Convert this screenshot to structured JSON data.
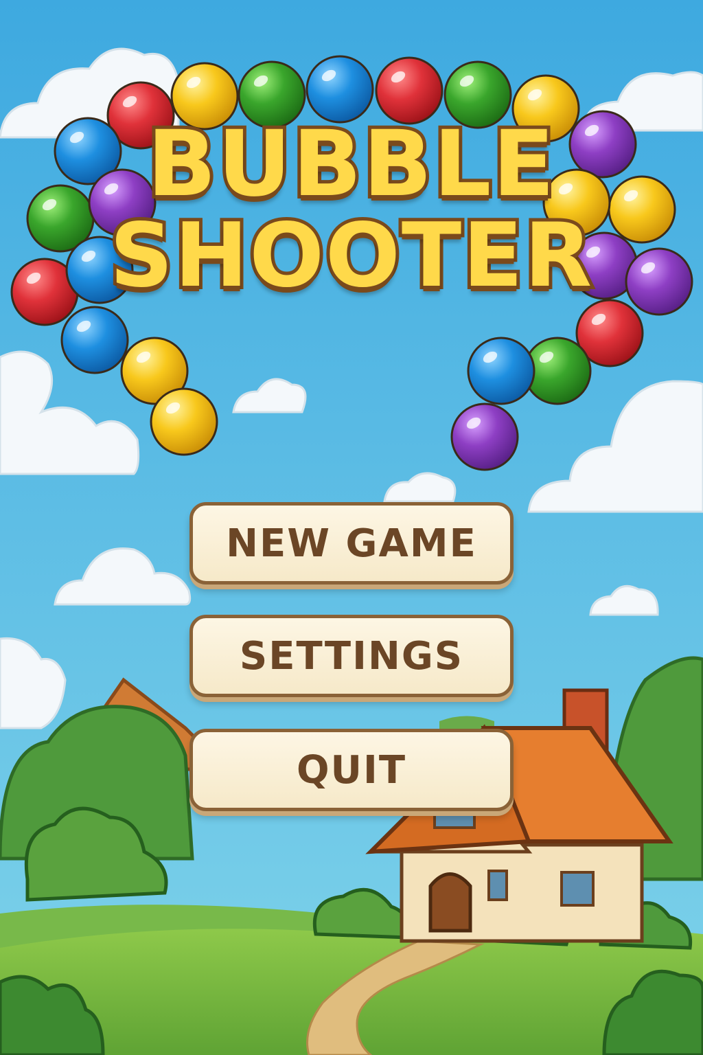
{
  "title": {
    "line1": "BUBBLE",
    "line2": "SHOOTER"
  },
  "menu": {
    "new_game": "NEW GAME",
    "settings": "SETTINGS",
    "quit": "QUIT"
  },
  "bubbles": [
    {
      "color": "red"
    },
    {
      "color": "yellow"
    },
    {
      "color": "green"
    },
    {
      "color": "blue"
    },
    {
      "color": "red"
    },
    {
      "color": "green"
    },
    {
      "color": "yellow"
    },
    {
      "color": "blue"
    },
    {
      "color": "purple"
    },
    {
      "color": "green"
    },
    {
      "color": "purple"
    },
    {
      "color": "yellow"
    },
    {
      "color": "red"
    },
    {
      "color": "blue"
    },
    {
      "color": "yellow"
    },
    {
      "color": "purple"
    },
    {
      "color": "blue"
    },
    {
      "color": "yellow"
    },
    {
      "color": "purple"
    },
    {
      "color": "red"
    },
    {
      "color": "green"
    },
    {
      "color": "blue"
    },
    {
      "color": "yellow"
    },
    {
      "color": "purple"
    }
  ],
  "colors": {
    "sky_top": "#3ea9e0",
    "sky_bottom": "#7fd3ea",
    "red": "#e0323a",
    "yellow": "#f8c81c",
    "green": "#3aa62c",
    "blue": "#1e8fe0",
    "purple": "#8e3fc4",
    "title_fill": "#ffd94a",
    "title_outline": "#7a4a1c",
    "button_bg": "#fdf6e4",
    "button_border": "#8a6237",
    "button_text": "#6b4626"
  }
}
